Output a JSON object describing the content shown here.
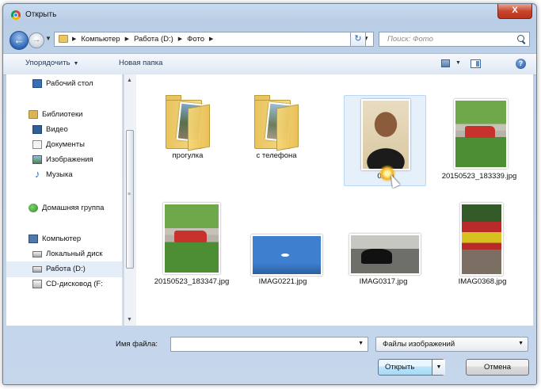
{
  "window": {
    "title": "Открыть",
    "close_label": "X"
  },
  "nav": {
    "breadcrumbs": [
      "Компьютер",
      "Работа (D:)",
      "Фото"
    ],
    "search_placeholder": "Поиск: Фото"
  },
  "toolbar": {
    "organize_label": "Упорядочить",
    "new_folder_label": "Новая папка"
  },
  "sidebar": {
    "items": [
      {
        "label": "Рабочий стол",
        "icon": "desktop-icon"
      },
      {
        "label": "Библиотеки",
        "icon": "libraries-icon"
      },
      {
        "label": "Видео",
        "icon": "video-icon"
      },
      {
        "label": "Документы",
        "icon": "documents-icon"
      },
      {
        "label": "Изображения",
        "icon": "pictures-icon"
      },
      {
        "label": "Музыка",
        "icon": "music-icon"
      },
      {
        "label": "Домашняя группа",
        "icon": "homegroup-icon"
      },
      {
        "label": "Компьютер",
        "icon": "computer-icon"
      },
      {
        "label": "Локальный диск",
        "icon": "local-disk-icon"
      },
      {
        "label": "Работа (D:)",
        "icon": "drive-icon",
        "selected": true
      },
      {
        "label": "CD-дисковод (F:",
        "icon": "cd-drive-icon"
      }
    ]
  },
  "files": [
    {
      "name": "прогулка",
      "type": "folder"
    },
    {
      "name": "с телефона",
      "type": "folder"
    },
    {
      "name": "0129",
      "type": "image",
      "selected": true
    },
    {
      "name": "20150523_183339.jpg",
      "type": "image"
    },
    {
      "name": "20150523_183347.jpg",
      "type": "image"
    },
    {
      "name": "IMAG0221.jpg",
      "type": "image"
    },
    {
      "name": "IMAG0317.jpg",
      "type": "image"
    },
    {
      "name": "IMAG0368.jpg",
      "type": "image"
    }
  ],
  "bottom": {
    "filename_label": "Имя файла:",
    "filename_value": "",
    "filetype_value": "Файлы изображений",
    "open_label": "Открыть",
    "cancel_label": "Отмена"
  }
}
